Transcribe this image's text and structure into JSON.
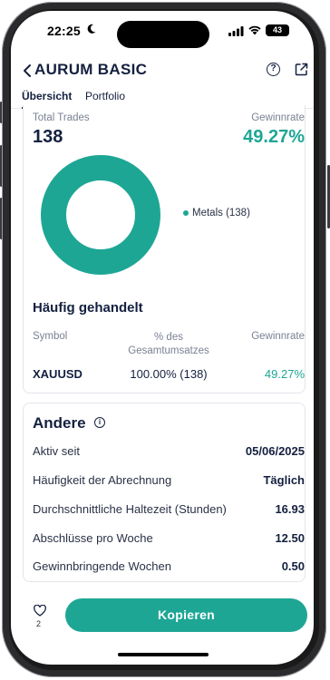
{
  "status_bar": {
    "time": "22:25",
    "battery": "43"
  },
  "header": {
    "title": "AURUM BASIC"
  },
  "tabs": [
    {
      "label": "Übersicht",
      "active": true
    },
    {
      "label": "Portfolio",
      "active": false
    }
  ],
  "summary": {
    "total_trades_label": "Total Trades",
    "total_trades_value": "138",
    "win_rate_label": "Gewinnrate",
    "win_rate_value": "49.27%"
  },
  "chart_data": {
    "type": "pie",
    "categories": [
      "Metals"
    ],
    "values": [
      138
    ],
    "legend": [
      "Metals (138)"
    ],
    "colors": [
      "#1ea695"
    ],
    "donut": true,
    "legend_position": "right"
  },
  "frequently_traded": {
    "title": "Häufig gehandelt",
    "columns": [
      "Symbol",
      "% des Gesamtumsatzes",
      "Gewinnrate"
    ],
    "rows": [
      {
        "symbol": "XAUUSD",
        "share": "100.00% (138)",
        "win_rate": "49.27%"
      }
    ]
  },
  "other": {
    "title": "Andere",
    "rows": [
      {
        "label": "Aktiv seit",
        "value": "05/06/2025"
      },
      {
        "label": "Häufigkeit der Abrechnung",
        "value": "Täglich"
      },
      {
        "label": "Durchschnittliche Haltezeit (Stunden)",
        "value": "16.93"
      },
      {
        "label": "Abschlüsse pro Woche",
        "value": "12.50"
      },
      {
        "label": "Gewinnbringende Wochen",
        "value": "0.50"
      }
    ]
  },
  "footer": {
    "favorites_count": "2",
    "copy_label": "Kopieren"
  },
  "colors": {
    "accent": "#1ea695",
    "navy": "#14203f"
  },
  "icons": [
    "moon-icon",
    "signal-icon",
    "wifi-icon",
    "back-icon",
    "help-icon",
    "share-icon",
    "info-icon",
    "heart-icon"
  ]
}
